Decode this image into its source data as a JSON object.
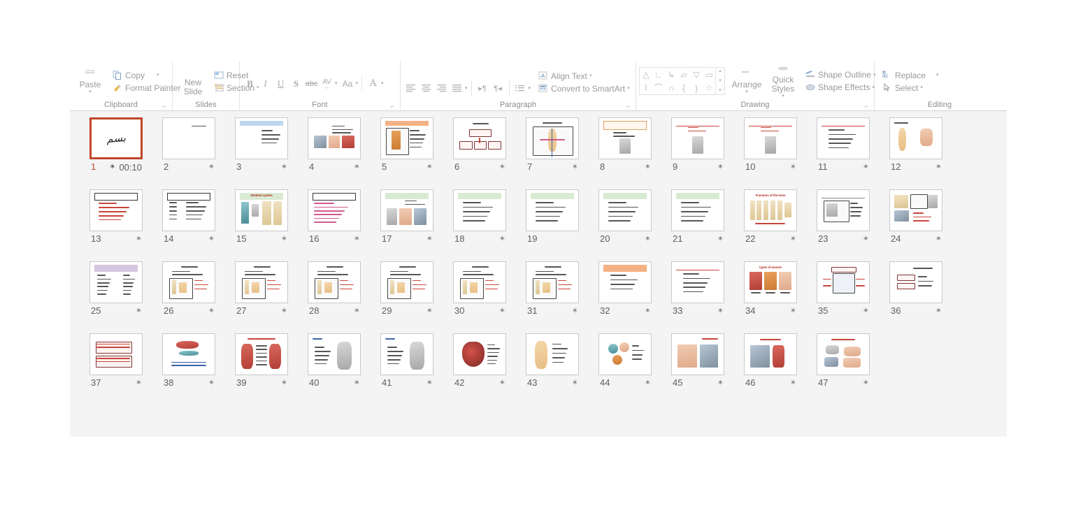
{
  "ribbon": {
    "groups": [
      {
        "name": "clipboard",
        "label": "Clipboard",
        "items": [
          {
            "name": "paste-button",
            "label": "Paste",
            "icon": "clipboard-icon"
          },
          {
            "name": "copy-button",
            "label": "Copy",
            "icon": "copy-icon"
          },
          {
            "name": "format-painter-button",
            "label": "Format Painter",
            "icon": "paintbrush-icon"
          }
        ]
      },
      {
        "name": "slides",
        "label": "Slides",
        "items": [
          {
            "name": "new-slide-button",
            "label": "New\nSlide",
            "icon": "new-slide-icon"
          },
          {
            "name": "reset-button",
            "label": "Reset",
            "icon": "reset-icon"
          },
          {
            "name": "section-button",
            "label": "Section",
            "icon": "section-icon"
          }
        ]
      },
      {
        "name": "font",
        "label": "Font",
        "items": [
          {
            "name": "bold-button",
            "label": "B",
            "icon": "bold-icon"
          },
          {
            "name": "italic-button",
            "label": "I",
            "icon": "italic-icon"
          },
          {
            "name": "underline-button",
            "label": "U",
            "icon": "underline-icon"
          },
          {
            "name": "text-shadow-button",
            "label": "S",
            "icon": "text-shadow-icon"
          },
          {
            "name": "strikethrough-button",
            "label": "abc",
            "icon": "strikethrough-icon"
          },
          {
            "name": "character-spacing-button",
            "label": "AV",
            "icon": "character-spacing-icon"
          },
          {
            "name": "change-case-button",
            "label": "Aa",
            "icon": "change-case-icon"
          },
          {
            "name": "font-color-button",
            "label": "A",
            "icon": "font-color-icon"
          }
        ]
      },
      {
        "name": "paragraph",
        "label": "Paragraph",
        "items": [
          {
            "name": "align-left-button",
            "label": "",
            "icon": "align-left-icon"
          },
          {
            "name": "align-center-button",
            "label": "",
            "icon": "align-center-icon"
          },
          {
            "name": "align-right-button",
            "label": "",
            "icon": "align-right-icon"
          },
          {
            "name": "justify-button",
            "label": "",
            "icon": "justify-icon"
          },
          {
            "name": "decrease-indent-button",
            "label": "",
            "icon": "decrease-indent-icon"
          },
          {
            "name": "increase-indent-button",
            "label": "",
            "icon": "increase-indent-icon"
          },
          {
            "name": "line-spacing-button",
            "label": "",
            "icon": "line-spacing-icon"
          },
          {
            "name": "align-text-button",
            "label": "Align Text",
            "icon": "align-text-icon"
          },
          {
            "name": "convert-to-smartart-button",
            "label": "Convert to SmartArt",
            "icon": "smartart-icon"
          }
        ]
      },
      {
        "name": "drawing",
        "label": "Drawing",
        "items": [
          {
            "name": "arrange-button",
            "label": "Arrange",
            "icon": "arrange-icon"
          },
          {
            "name": "quick-styles-button",
            "label": "Quick\nStyles",
            "icon": "quick-styles-icon"
          },
          {
            "name": "shape-outline-button",
            "label": "Shape Outline",
            "icon": "shape-outline-icon"
          },
          {
            "name": "shape-effects-button",
            "label": "Shape Effects",
            "icon": "shape-effects-icon"
          }
        ],
        "shape_gallery": [
          "△",
          "∟",
          "↳",
          "▱",
          "▽",
          "▭",
          "⌇",
          "⌒",
          "∩",
          "{",
          "}",
          "☆"
        ]
      },
      {
        "name": "editing",
        "label": "Editing",
        "items": [
          {
            "name": "replace-button",
            "label": "Replace",
            "icon": "replace-icon"
          },
          {
            "name": "select-button",
            "label": "Select",
            "icon": "select-pointer-icon"
          }
        ]
      }
    ]
  },
  "slide_sorter": {
    "selected_slide": 1,
    "transition_star": "✶",
    "slides": [
      {
        "number": "1",
        "duration": "00:10",
        "star": true,
        "selected": true,
        "kind": "calligraphy",
        "title": ""
      },
      {
        "number": "2",
        "duration": "",
        "star": true,
        "kind": "title-only",
        "title": ""
      },
      {
        "number": "3",
        "duration": "",
        "star": true,
        "kind": "blue-header-text",
        "title": ""
      },
      {
        "number": "4",
        "duration": "",
        "star": true,
        "kind": "photos-text",
        "title": ""
      },
      {
        "number": "5",
        "duration": "",
        "star": true,
        "kind": "orange-header-figure",
        "title": ""
      },
      {
        "number": "6",
        "duration": "",
        "star": true,
        "kind": "flowchart",
        "title": ""
      },
      {
        "number": "7",
        "duration": "",
        "star": true,
        "kind": "body-planes",
        "title": ""
      },
      {
        "number": "8",
        "duration": "",
        "star": true,
        "kind": "orange-header-small-figure",
        "title": ""
      },
      {
        "number": "9",
        "duration": "",
        "star": true,
        "kind": "red-header-small-figure",
        "title": ""
      },
      {
        "number": "10",
        "duration": "",
        "star": true,
        "kind": "red-header-small-figure",
        "title": ""
      },
      {
        "number": "11",
        "duration": "",
        "star": true,
        "kind": "red-header-text",
        "title": ""
      },
      {
        "number": "12",
        "duration": "",
        "star": true,
        "kind": "two-figures",
        "title": ""
      },
      {
        "number": "13",
        "duration": "",
        "star": true,
        "kind": "boxed-title-lines",
        "title": ""
      },
      {
        "number": "14",
        "duration": "",
        "star": true,
        "kind": "boxed-title-table",
        "title": ""
      },
      {
        "number": "15",
        "duration": "",
        "star": true,
        "kind": "skeletal-system",
        "title": "Skeletal system"
      },
      {
        "number": "16",
        "duration": "",
        "star": true,
        "kind": "boxed-title-pinktext",
        "title": ""
      },
      {
        "number": "17",
        "duration": "",
        "star": true,
        "kind": "green-header-photos",
        "title": ""
      },
      {
        "number": "18",
        "duration": "",
        "star": true,
        "kind": "green-header-text",
        "title": ""
      },
      {
        "number": "19",
        "duration": "",
        "star": false,
        "kind": "green-header-text",
        "title": ""
      },
      {
        "number": "20",
        "duration": "",
        "star": true,
        "kind": "green-header-text",
        "title": ""
      },
      {
        "number": "21",
        "duration": "",
        "star": true,
        "kind": "green-header-text",
        "title": ""
      },
      {
        "number": "22",
        "duration": "",
        "star": true,
        "kind": "fractures-of-bone",
        "title": "Fractures of the bone"
      },
      {
        "number": "23",
        "duration": "",
        "star": true,
        "kind": "gray-header-figure",
        "title": ""
      },
      {
        "number": "24",
        "duration": "",
        "star": true,
        "kind": "collage",
        "title": ""
      },
      {
        "number": "25",
        "duration": "",
        "star": true,
        "kind": "purple-header-table",
        "title": ""
      },
      {
        "number": "26",
        "duration": "",
        "star": true,
        "kind": "framed-figure-text",
        "title": ""
      },
      {
        "number": "27",
        "duration": "",
        "star": true,
        "kind": "framed-figure-text",
        "title": ""
      },
      {
        "number": "28",
        "duration": "",
        "star": true,
        "kind": "framed-figure-text",
        "title": ""
      },
      {
        "number": "29",
        "duration": "",
        "star": true,
        "kind": "framed-figure-text",
        "title": ""
      },
      {
        "number": "30",
        "duration": "",
        "star": true,
        "kind": "framed-figure-text",
        "title": ""
      },
      {
        "number": "31",
        "duration": "",
        "star": true,
        "kind": "framed-figure-text",
        "title": ""
      },
      {
        "number": "32",
        "duration": "",
        "star": true,
        "kind": "orange-header-text",
        "title": ""
      },
      {
        "number": "33",
        "duration": "",
        "star": true,
        "kind": "red-header-text",
        "title": ""
      },
      {
        "number": "34",
        "duration": "",
        "star": true,
        "kind": "types-of-muscle",
        "title": "types of muscle"
      },
      {
        "number": "35",
        "duration": "",
        "star": true,
        "kind": "diagram-red",
        "title": ""
      },
      {
        "number": "36",
        "duration": "",
        "star": true,
        "kind": "diagram-gray",
        "title": ""
      },
      {
        "number": "37",
        "duration": "",
        "star": true,
        "kind": "table-red-rows",
        "title": ""
      },
      {
        "number": "38",
        "duration": "",
        "star": true,
        "kind": "muscle-diagram",
        "title": ""
      },
      {
        "number": "39",
        "duration": "",
        "star": true,
        "kind": "two-muscle-figures",
        "title": ""
      },
      {
        "number": "40",
        "duration": "",
        "star": true,
        "kind": "gray-body-figure",
        "title": ""
      },
      {
        "number": "41",
        "duration": "",
        "star": true,
        "kind": "gray-body-figure",
        "title": ""
      },
      {
        "number": "42",
        "duration": "",
        "star": true,
        "kind": "heart-diagram",
        "title": ""
      },
      {
        "number": "43",
        "duration": "",
        "star": true,
        "kind": "body-figure-labels",
        "title": ""
      },
      {
        "number": "44",
        "duration": "",
        "star": true,
        "kind": "cells-diagram",
        "title": ""
      },
      {
        "number": "45",
        "duration": "",
        "star": true,
        "kind": "photo-people",
        "title": ""
      },
      {
        "number": "46",
        "duration": "",
        "star": true,
        "kind": "photo-leg",
        "title": ""
      },
      {
        "number": "47",
        "duration": "",
        "star": true,
        "kind": "photo-bandage",
        "title": ""
      }
    ]
  },
  "colors": {
    "selection": "#c0462a",
    "workspace_bg": "#f4f4f4",
    "ribbon_text": "#9a9a9a",
    "slide_number": "#5e5e5e"
  }
}
